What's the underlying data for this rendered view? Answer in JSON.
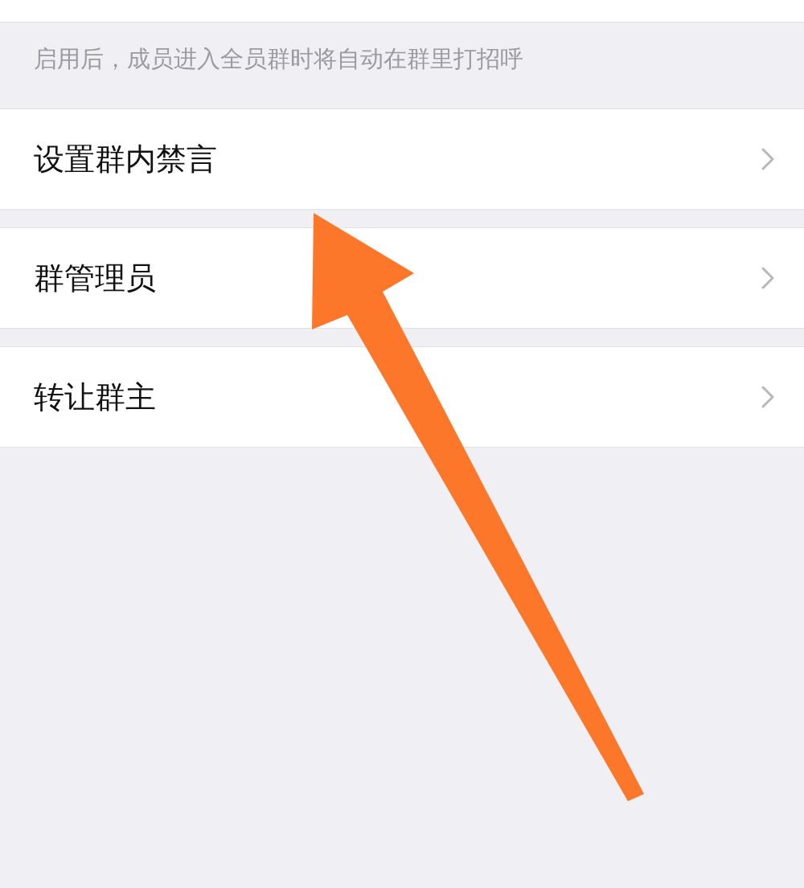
{
  "hint": "启用后，成员进入全员群时将自动在群里打招呼",
  "items": [
    {
      "label": "设置群内禁言"
    },
    {
      "label": "群管理员"
    },
    {
      "label": "转让群主"
    }
  ]
}
